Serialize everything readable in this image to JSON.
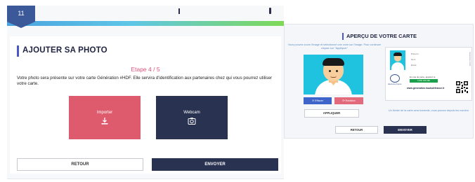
{
  "step_badge": "11",
  "left": {
    "title": "AJOUTER SA PHOTO",
    "step": "Etape 4 / 5",
    "description": "Votre photo sera présente sur votre carte Génération #HDF. Elle servira d'identification aux partenaires chez qui vous pourrez utiliser votre carte.",
    "import_label": "Importer",
    "webcam_label": "Webcam",
    "retour_label": "RETOUR",
    "envoyer_label": "ENVOYER"
  },
  "right": {
    "title": "APERÇU DE VOTRE CARTE",
    "hint": "Vous pouvez zoom l'image et sélectionné une zone sur l'image. Pour continuer cliquez sur \"Appliquer\"",
    "reset_label": "✕ Effacer",
    "rotate_label": "⟳ Rotation",
    "apply_label": "APPLIQUER",
    "card": {
      "field_prenom": "Prénom",
      "field_nom": "Nom",
      "field_ecole": "École",
      "vertical_text": "Génération #HDF",
      "logo_label": "Hauts-de-France",
      "contact_text": "En cas de perte, appelez le",
      "phone": "0 800 026 080",
      "url": "www.generation.hautsdefrance.fr"
    },
    "note": "Un fichier de la carte sera transmis, vous pouvez depuis les numéro",
    "retour_label": "RETOUR",
    "envoyer_label": "ENVOYER"
  },
  "colors": {
    "accent_blue": "#4a57c8",
    "import_tile": "#de5b6d",
    "dark_navy": "#2a3252",
    "step_pink": "#e0527a",
    "photo_bg": "#1fc3e0",
    "phone_green": "#1aa04b"
  },
  "icons": {
    "import": "download-icon",
    "webcam": "camera-icon",
    "reset": "close-icon",
    "rotate": "rotate-icon"
  }
}
